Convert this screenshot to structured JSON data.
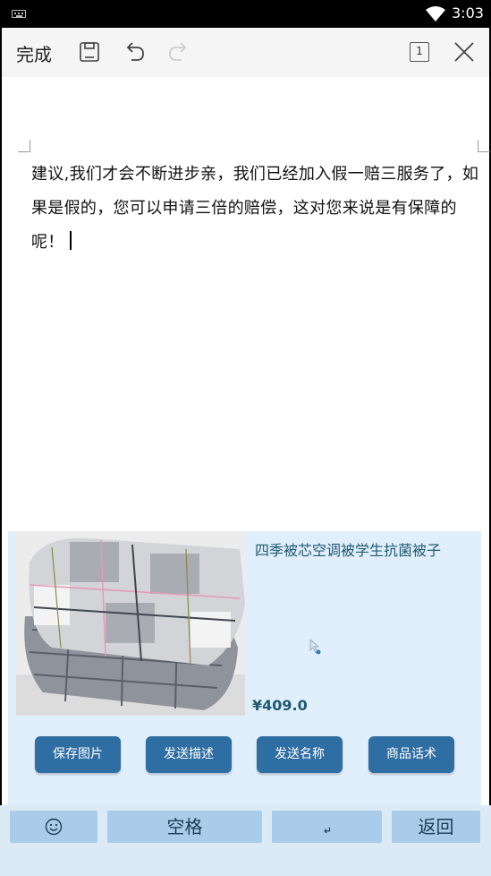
{
  "status_bar": {
    "time": "3:03",
    "icons": [
      "keyboard-icon",
      "wifi-icon"
    ]
  },
  "toolbar": {
    "done_label": "完成",
    "icons": [
      "save-icon",
      "undo-icon",
      "redo-icon",
      "close-icon"
    ],
    "page_number": "1"
  },
  "document": {
    "text": "建议,我们才会不断进步亲，我们已经加入假一赔三服务了，如果是假的，您可以申请三倍的赔偿，这对您来说是有保障的呢！"
  },
  "product": {
    "title": "四季被芯空调被学生抗菌被子",
    "price": "¥409.0",
    "image": "folded-plaid-quilt"
  },
  "actions": [
    {
      "label": "保存图片"
    },
    {
      "label": "发送描述"
    },
    {
      "label": "发送名称"
    },
    {
      "label": "商品话术"
    }
  ],
  "keyboard": {
    "emoji_icon": "smiley-icon",
    "space_label": "空格",
    "enter_icon": "enter-icon",
    "back_label": "返回"
  },
  "colors": {
    "card_bg": "#e1eefb",
    "button_bg": "#2f6ea3",
    "key_bg": "#a9ccea",
    "accent_text": "#1e5a72"
  }
}
